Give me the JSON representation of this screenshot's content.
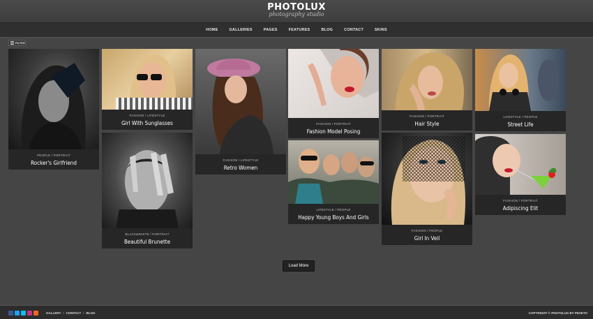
{
  "brand": {
    "title": "PHOTOLUX",
    "subtitle": "photography studio"
  },
  "nav": {
    "items": [
      "HOME",
      "GALLERIES",
      "PAGES",
      "FEATURES",
      "BLOG",
      "CONTACT",
      "SKINS"
    ]
  },
  "filter": {
    "label": "FILTER",
    "icon": "filter-icon"
  },
  "gallery": {
    "items": [
      {
        "category": "PEOPLE / PORTRAIT",
        "title": "Rocker's Girlfriend"
      },
      {
        "category": "FASHION / LIFESTYLE",
        "title": "Girl With Sunglasses"
      },
      {
        "category": "BLACK&WHITE / PORTRAIT",
        "title": "Beautiful Brunette"
      },
      {
        "category": "FASHION / LIFESTYLE",
        "title": "Retro Women"
      },
      {
        "category": "FASHION / PORTRAIT",
        "title": "Fashion Model Posing"
      },
      {
        "category": "LIFESTYLE / PEOPLE",
        "title": "Happy Young Boys And Girls"
      },
      {
        "category": "FASHION / PORTRAIT",
        "title": "Hair Style"
      },
      {
        "category": "FASHION / PEOPLE",
        "title": "Girl In Veil"
      },
      {
        "category": "LIFESTYLE / PEOPLE",
        "title": "Street Life"
      },
      {
        "category": "FASHION / PORTRAIT",
        "title": "Adipiscing Elit"
      }
    ]
  },
  "load_more": {
    "label": "Load More"
  },
  "footer": {
    "social_icons": [
      "facebook-icon",
      "twitter-icon",
      "vimeo-icon",
      "instagram-icon",
      "rss-icon"
    ],
    "social_colors": [
      "#3b5998",
      "#1da1f2",
      "#1ab7ea",
      "#c13584",
      "#f26522"
    ],
    "links": [
      "GALLERY",
      "CONTACT",
      "BLOG"
    ],
    "copyright": "COPYRIGHT © PHOTOLUX BY PEXETO"
  }
}
